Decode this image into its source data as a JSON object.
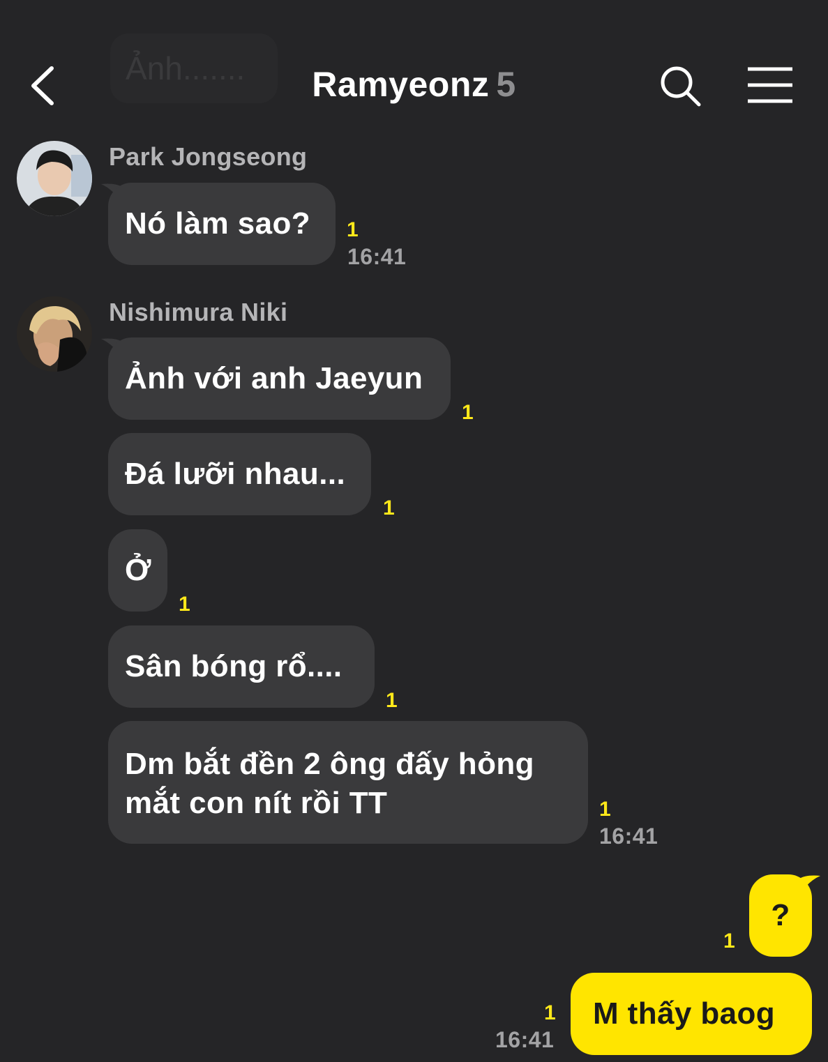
{
  "header": {
    "title": "Ramyeonz",
    "member_count": "5",
    "ghost_text": "Ảnh......."
  },
  "messages": [
    {
      "sender": "Park Jongseong",
      "text": "Nó làm sao?",
      "unread": "1",
      "time": "16:41"
    },
    {
      "sender": "Nishimura Niki",
      "text": "Ảnh với anh Jaeyun",
      "unread": "1"
    },
    {
      "text": "Đá lưỡi nhau...",
      "unread": "1"
    },
    {
      "text": "Ở",
      "unread": "1"
    },
    {
      "text": "Sân bóng rổ....",
      "unread": "1"
    },
    {
      "text": "Dm bắt đền 2 ông đấy hỏng mắt con nít rồi TT",
      "unread": "1",
      "time": "16:41"
    }
  ],
  "my_messages": [
    {
      "text": "?",
      "unread": "1"
    },
    {
      "text": "M thấy baog",
      "unread": "1",
      "time": "16:41"
    }
  ],
  "icons": {
    "back": "chevron-left-icon",
    "search": "search-icon",
    "menu": "hamburger-menu-icon"
  },
  "colors": {
    "background": "#252527",
    "incoming_bubble": "#3a3a3c",
    "outgoing_bubble": "#ffe500",
    "unread": "#ffe81a",
    "timestamp": "#a3a3a5"
  }
}
